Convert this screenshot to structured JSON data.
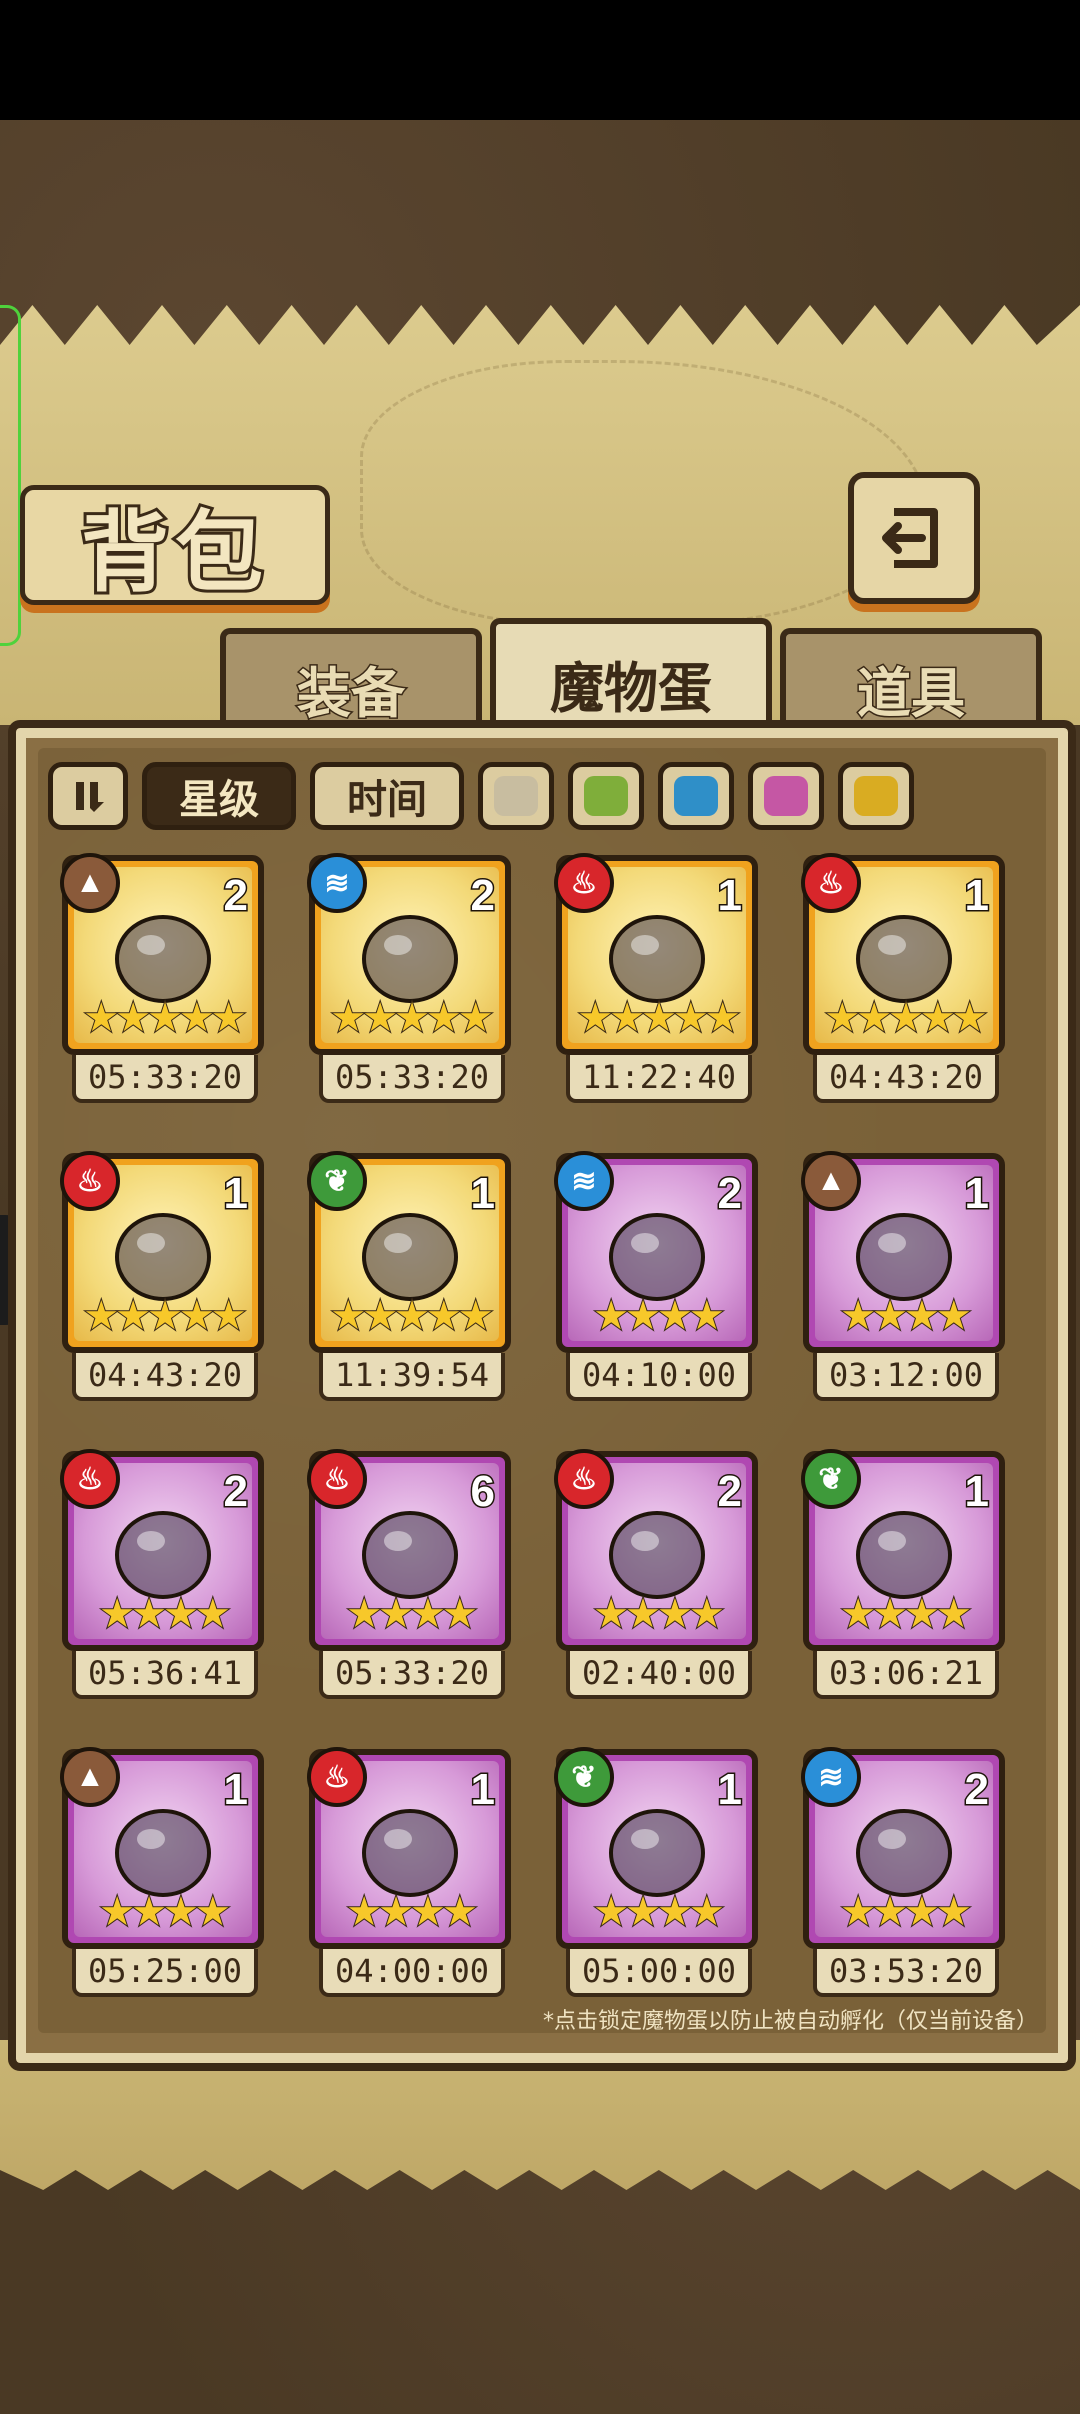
{
  "header": {
    "title": "背包",
    "back_icon": "back-arrow-icon"
  },
  "tabs": [
    {
      "label": "装备",
      "active": false
    },
    {
      "label": "魔物蛋",
      "active": true
    },
    {
      "label": "道具",
      "active": false
    }
  ],
  "filters": {
    "toggle_icon": "pause-sort-icon",
    "sort_star": "星级",
    "sort_time": "时间",
    "swatches": [
      "#c8bda0",
      "#7fae3a",
      "#2f8fc8",
      "#c557a4",
      "#d9ac22"
    ]
  },
  "colors": {
    "gold_frame": "#f0a21e",
    "purple_frame": "#b048b2",
    "fire": "#d8262b",
    "water": "#2a8fd8",
    "nature": "#3e9a3a",
    "earth": "#8a5a3a"
  },
  "eggs": [
    {
      "element": "earth",
      "count": "2",
      "stars": 5,
      "rarity": "gold",
      "timer": "05:33:20",
      "icon": "hammer-icon"
    },
    {
      "element": "water",
      "count": "2",
      "stars": 5,
      "rarity": "gold",
      "timer": "05:33:20",
      "icon": "sword-icon"
    },
    {
      "element": "fire",
      "count": "1",
      "stars": 5,
      "rarity": "gold",
      "timer": "11:22:40",
      "icon": "pirate-hat-icon"
    },
    {
      "element": "fire",
      "count": "1",
      "stars": 5,
      "rarity": "gold",
      "timer": "04:43:20",
      "icon": "wizard-hat-icon"
    },
    {
      "element": "fire",
      "count": "1",
      "stars": 5,
      "rarity": "gold",
      "timer": "04:43:20",
      "icon": "whip-icon"
    },
    {
      "element": "nature",
      "count": "1",
      "stars": 5,
      "rarity": "gold",
      "timer": "11:39:54",
      "icon": "lotus-egg-icon"
    },
    {
      "element": "water",
      "count": "2",
      "stars": 4,
      "rarity": "purple",
      "timer": "04:10:00",
      "icon": "slime-icon"
    },
    {
      "element": "earth",
      "count": "1",
      "stars": 4,
      "rarity": "purple",
      "timer": "03:12:00",
      "icon": "cracked-egg-icon"
    },
    {
      "element": "fire",
      "count": "2",
      "stars": 4,
      "rarity": "purple",
      "timer": "05:36:41",
      "icon": "flags-icon"
    },
    {
      "element": "fire",
      "count": "6",
      "stars": 4,
      "rarity": "purple",
      "timer": "05:33:20",
      "icon": "dagger-icon"
    },
    {
      "element": "fire",
      "count": "2",
      "stars": 4,
      "rarity": "purple",
      "timer": "02:40:00",
      "icon": "dark-egg-icon"
    },
    {
      "element": "nature",
      "count": "1",
      "stars": 4,
      "rarity": "purple",
      "timer": "03:06:21",
      "icon": "feather-egg-icon"
    },
    {
      "element": "earth",
      "count": "1",
      "stars": 4,
      "rarity": "purple",
      "timer": "05:25:00",
      "icon": "fur-egg-icon"
    },
    {
      "element": "fire",
      "count": "1",
      "stars": 4,
      "rarity": "purple",
      "timer": "04:00:00",
      "icon": "pink-spirit-icon"
    },
    {
      "element": "nature",
      "count": "1",
      "stars": 4,
      "rarity": "purple",
      "timer": "05:00:00",
      "icon": "scythe-icon"
    },
    {
      "element": "water",
      "count": "2",
      "stars": 4,
      "rarity": "purple",
      "timer": "03:53:20",
      "icon": "pudding-icon"
    }
  ],
  "footnote": "*点击锁定魔物蛋以防止被自动孵化（仅当前设备）"
}
